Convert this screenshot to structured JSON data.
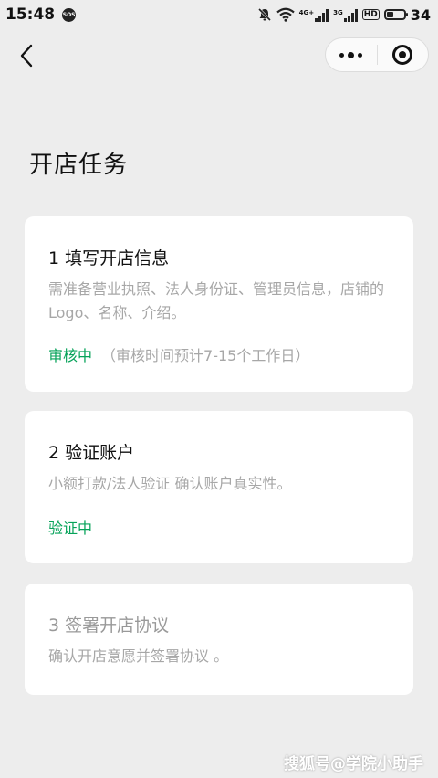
{
  "status_bar": {
    "time": "15:48",
    "sos": "SOS",
    "net_1": "4G+",
    "net_2": "3G",
    "hd": "HD",
    "battery": "34"
  },
  "nav": {
    "back_icon": "chevron-left-icon",
    "more_icon": "more-dots-icon",
    "close_icon": "target-circle-icon"
  },
  "page": {
    "title": "开店任务"
  },
  "tasks": [
    {
      "title": "1 填写开店信息",
      "desc": "需准备营业执照、法人身份证、管理员信息，店铺的Logo、名称、介绍。",
      "status": "审核中",
      "note": "（审核时间预计7-15个工作日）"
    },
    {
      "title": "2 验证账户",
      "desc": "小额打款/法人验证 确认账户真实性。",
      "status": "验证中",
      "note": ""
    },
    {
      "title": "3 签署开店协议",
      "desc": "确认开店意愿并签署协议 。",
      "status": "",
      "note": ""
    }
  ],
  "colors": {
    "background": "#ededed",
    "card": "#ffffff",
    "status_green": "#07a35a",
    "muted_text": "#a7a7a7"
  },
  "watermark": "搜狐号@学院小助手"
}
